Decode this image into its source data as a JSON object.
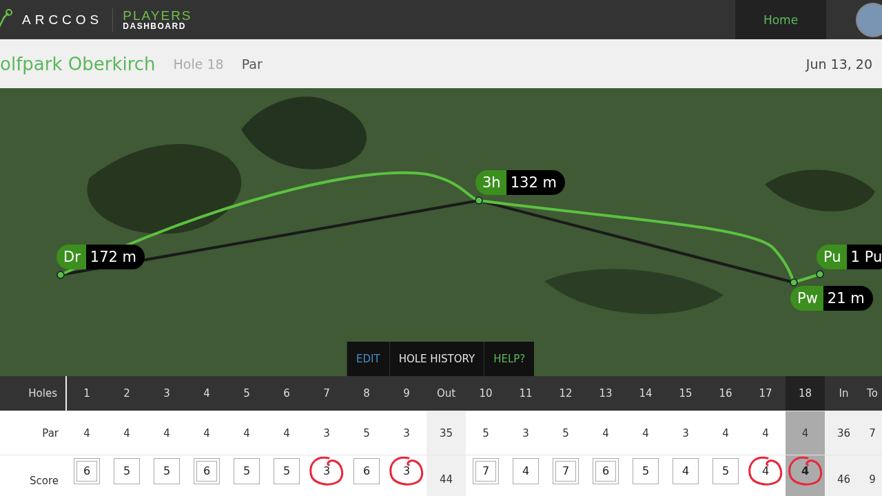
{
  "header": {
    "brand": "ARCCOS",
    "product_top": "PLAYERS",
    "product_bottom": "DASHBOARD",
    "nav": [
      {
        "label": "Home",
        "selected": true
      }
    ]
  },
  "round": {
    "course": "olfpark Oberkirch",
    "hole": "Hole 18",
    "par_label": "Par",
    "date": "Jun 13, 20"
  },
  "shots": [
    {
      "club": "Dr",
      "distance": "172 m"
    },
    {
      "club": "3h",
      "distance": "132 m"
    },
    {
      "club": "Pu",
      "distance": "1 Pu"
    },
    {
      "club": "Pw",
      "distance": "21 m"
    }
  ],
  "map_actions": [
    {
      "label": "EDIT",
      "kind": "edit"
    },
    {
      "label": "HOLE HISTORY",
      "kind": "history"
    },
    {
      "label": "HELP?",
      "kind": "help"
    }
  ],
  "scorecard": {
    "row_labels": [
      "Holes",
      "Par",
      "Score"
    ],
    "columns": [
      {
        "kind": "hole",
        "label": "1",
        "par": "4",
        "score": {
          "value": "6",
          "kind": "double_box",
          "circled": false
        },
        "selected": false
      },
      {
        "kind": "hole",
        "label": "2",
        "par": "4",
        "score": {
          "value": "5",
          "kind": "box",
          "circled": false
        },
        "selected": false
      },
      {
        "kind": "hole",
        "label": "3",
        "par": "4",
        "score": {
          "value": "5",
          "kind": "box",
          "circled": false
        },
        "selected": false
      },
      {
        "kind": "hole",
        "label": "4",
        "par": "4",
        "score": {
          "value": "6",
          "kind": "double_box",
          "circled": false
        },
        "selected": false
      },
      {
        "kind": "hole",
        "label": "5",
        "par": "4",
        "score": {
          "value": "5",
          "kind": "box",
          "circled": false
        },
        "selected": false
      },
      {
        "kind": "hole",
        "label": "6",
        "par": "4",
        "score": {
          "value": "5",
          "kind": "box",
          "circled": false
        },
        "selected": false
      },
      {
        "kind": "hole",
        "label": "7",
        "par": "3",
        "score": {
          "value": "3",
          "kind": "plain",
          "circled": true
        },
        "selected": false
      },
      {
        "kind": "hole",
        "label": "8",
        "par": "5",
        "score": {
          "value": "6",
          "kind": "box",
          "circled": false
        },
        "selected": false
      },
      {
        "kind": "hole",
        "label": "9",
        "par": "3",
        "score": {
          "value": "3",
          "kind": "plain",
          "circled": true
        },
        "selected": false
      },
      {
        "kind": "total",
        "label": "Out",
        "par": "35",
        "score": {
          "value": "44"
        }
      },
      {
        "kind": "hole",
        "label": "10",
        "par": "5",
        "score": {
          "value": "7",
          "kind": "double_box",
          "circled": false
        },
        "selected": false
      },
      {
        "kind": "hole",
        "label": "11",
        "par": "3",
        "score": {
          "value": "4",
          "kind": "box",
          "circled": false
        },
        "selected": false
      },
      {
        "kind": "hole",
        "label": "12",
        "par": "5",
        "score": {
          "value": "7",
          "kind": "double_box",
          "circled": false
        },
        "selected": false
      },
      {
        "kind": "hole",
        "label": "13",
        "par": "4",
        "score": {
          "value": "6",
          "kind": "double_box",
          "circled": false
        },
        "selected": false
      },
      {
        "kind": "hole",
        "label": "14",
        "par": "4",
        "score": {
          "value": "5",
          "kind": "box",
          "circled": false
        },
        "selected": false
      },
      {
        "kind": "hole",
        "label": "15",
        "par": "3",
        "score": {
          "value": "4",
          "kind": "box",
          "circled": false
        },
        "selected": false
      },
      {
        "kind": "hole",
        "label": "16",
        "par": "4",
        "score": {
          "value": "5",
          "kind": "box",
          "circled": false
        },
        "selected": false
      },
      {
        "kind": "hole",
        "label": "17",
        "par": "4",
        "score": {
          "value": "4",
          "kind": "plain",
          "circled": true
        },
        "selected": false
      },
      {
        "kind": "hole",
        "label": "18",
        "par": "4",
        "score": {
          "value": "4",
          "kind": "plain",
          "circled": true
        },
        "selected": true
      },
      {
        "kind": "total",
        "label": "In",
        "par": "36",
        "score": {
          "value": "46"
        }
      },
      {
        "kind": "total",
        "label": "To",
        "par": "7",
        "score": {
          "value": "9"
        }
      }
    ]
  }
}
